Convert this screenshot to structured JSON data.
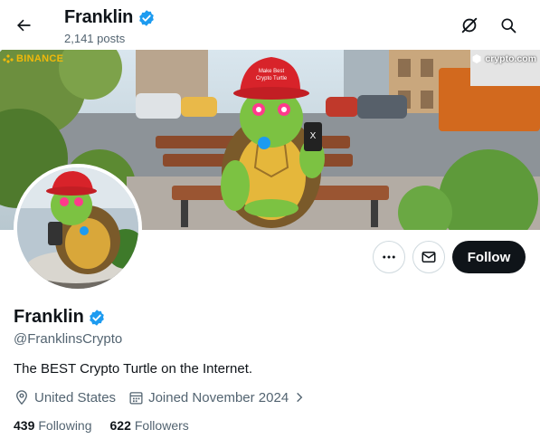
{
  "header": {
    "name": "Franklin",
    "posts_count": "2,141 posts"
  },
  "banner": {
    "left_logo": "BINANCE",
    "right_logo": "crypto.com",
    "hat_text": "Make Best Crypto Turtle"
  },
  "profile": {
    "name": "Franklin",
    "handle": "@FranklinsCrypto",
    "bio": "The BEST Crypto Turtle on the Internet.",
    "location": "United States",
    "joined": "Joined November 2024",
    "following_count": "439",
    "following_label": "Following",
    "followers_count": "622",
    "followers_label": "Followers"
  },
  "actions": {
    "follow_label": "Follow"
  },
  "colors": {
    "verified_blue": "#1d9bf0",
    "follow_bg": "#0f1419",
    "secondary_text": "#536471"
  },
  "icons": [
    "back-arrow-icon",
    "verified-badge-icon",
    "grok-icon",
    "search-icon",
    "more-icon",
    "message-icon",
    "location-icon",
    "calendar-icon",
    "chevron-right-icon"
  ]
}
